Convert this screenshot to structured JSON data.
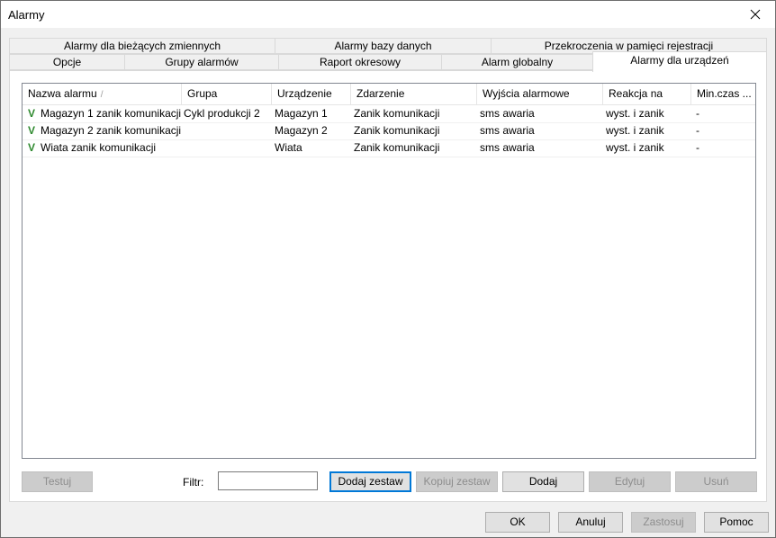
{
  "window": {
    "title": "Alarmy",
    "close_icon": "close-icon"
  },
  "tabs": {
    "row1": [
      "Alarmy dla bieżących zmiennych",
      "Alarmy bazy danych",
      "Przekroczenia w pamięci rejestracji"
    ],
    "row2": [
      "Opcje",
      "Grupy alarmów",
      "Raport okresowy",
      "Alarm globalny"
    ],
    "active": "Alarmy dla urządzeń"
  },
  "table": {
    "columns": [
      "Nazwa alarmu",
      "Grupa",
      "Urządzenie",
      "Zdarzenie",
      "Wyjścia alarmowe",
      "Reakcja na",
      "Min.czas ..."
    ],
    "sort_indicator": "/",
    "rows": [
      {
        "check": "V",
        "name": "Magazyn 1 zanik komunikacji",
        "group": "Cykl produkcji 2",
        "device": "Magazyn 1",
        "event": "Zanik komunikacji",
        "outputs": "sms awaria",
        "reaction": "wyst. i zanik",
        "min_time": "-"
      },
      {
        "check": "V",
        "name": "Magazyn 2 zanik komunikacji",
        "group": "",
        "device": "Magazyn 2",
        "event": "Zanik komunikacji",
        "outputs": "sms awaria",
        "reaction": "wyst. i zanik",
        "min_time": "-"
      },
      {
        "check": "V",
        "name": "Wiata zanik komunikacji",
        "group": "",
        "device": "Wiata",
        "event": "Zanik komunikacji",
        "outputs": "sms awaria",
        "reaction": "wyst. i zanik",
        "min_time": "-"
      }
    ]
  },
  "actions": {
    "test": "Testuj",
    "filter_label": "Filtr:",
    "filter_value": "",
    "add_set": "Dodaj zestaw",
    "copy_set": "Kopiuj zestaw",
    "add": "Dodaj",
    "edit": "Edytuj",
    "delete": "Usuń"
  },
  "footer": {
    "ok": "OK",
    "cancel": "Anuluj",
    "apply": "Zastosuj",
    "help": "Pomoc"
  },
  "colors": {
    "check_green": "#2f8a2f",
    "focus_blue": "#0078d7"
  }
}
